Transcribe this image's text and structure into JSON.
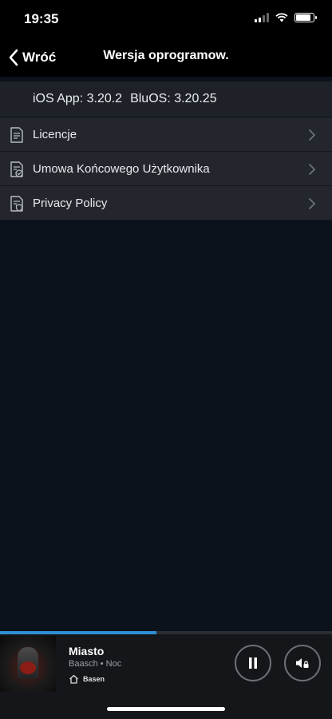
{
  "status": {
    "time": "19:35"
  },
  "nav": {
    "back_label": "Wróć",
    "title": "Wersja oprogramow."
  },
  "version": {
    "ios": "iOS App: 3.20.2",
    "bluos": "BluOS: 3.20.25"
  },
  "menu": {
    "items": [
      {
        "label": "Licencje",
        "icon": "document-icon"
      },
      {
        "label": "Umowa Końcowego Użytkownika",
        "icon": "document-check-icon"
      },
      {
        "label": "Privacy Policy",
        "icon": "document-shield-icon"
      }
    ]
  },
  "player": {
    "title": "Miasto",
    "subtitle": "Baasch • Noc",
    "room": "Basen",
    "progress": 0.47
  },
  "colors": {
    "accent": "#2f8fd6",
    "background": "#0c121b",
    "row": "#23272d"
  }
}
